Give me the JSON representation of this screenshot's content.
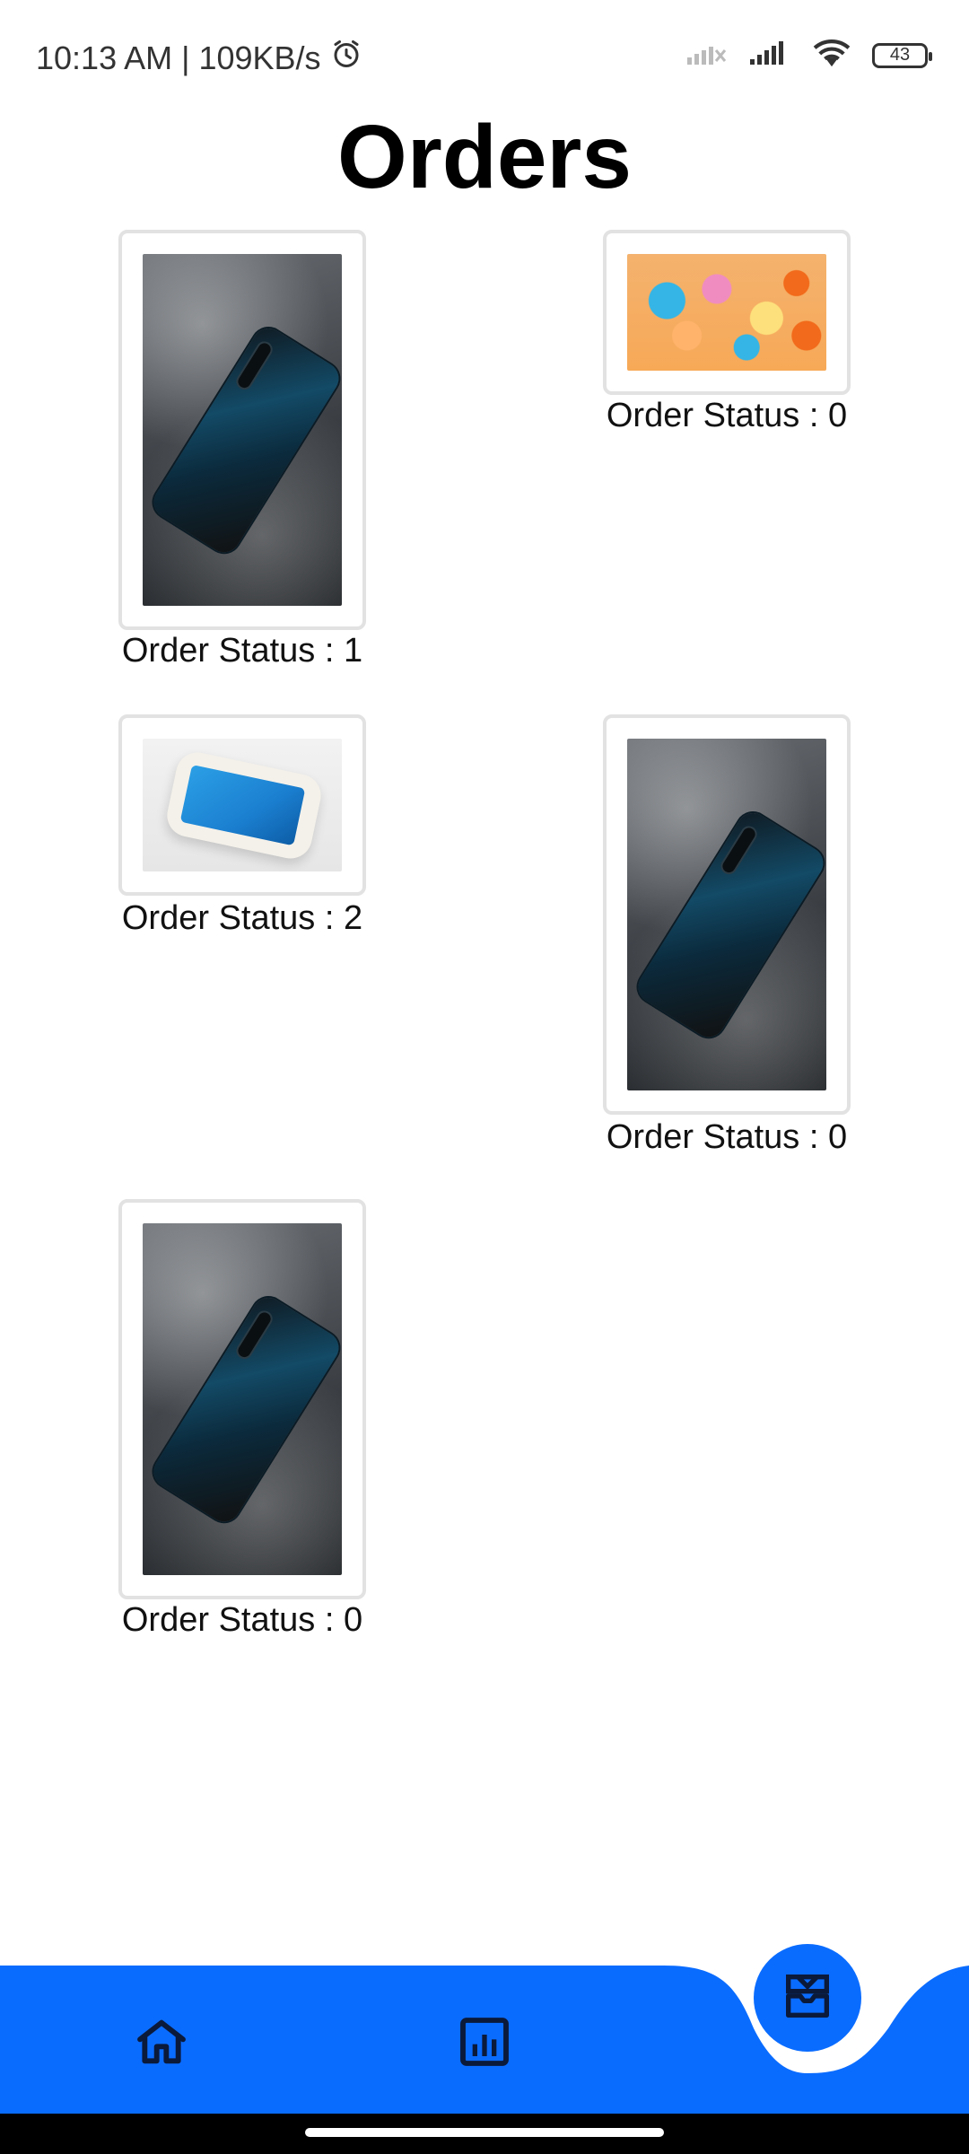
{
  "status_bar": {
    "time_speed": "10:13 AM | 109KB/s",
    "battery": "43"
  },
  "title": "Orders",
  "orders": [
    {
      "status_label": "Order Status : 1",
      "image": "black-xiaomi-phone"
    },
    {
      "status_label": "Order Status : 0",
      "image": "colorful-candy"
    },
    {
      "status_label": "Order Status : 2",
      "image": "white-iphone"
    },
    {
      "status_label": "Order Status : 0",
      "image": "black-xiaomi-phone"
    },
    {
      "status_label": "Order Status : 0",
      "image": "black-xiaomi-phone"
    }
  ],
  "nav": {
    "items": [
      "home-icon",
      "chart-icon",
      "inbox-icon"
    ],
    "active": "inbox-icon",
    "colors": {
      "bar": "#0a6cff",
      "icon": "#0b1a3a"
    }
  }
}
